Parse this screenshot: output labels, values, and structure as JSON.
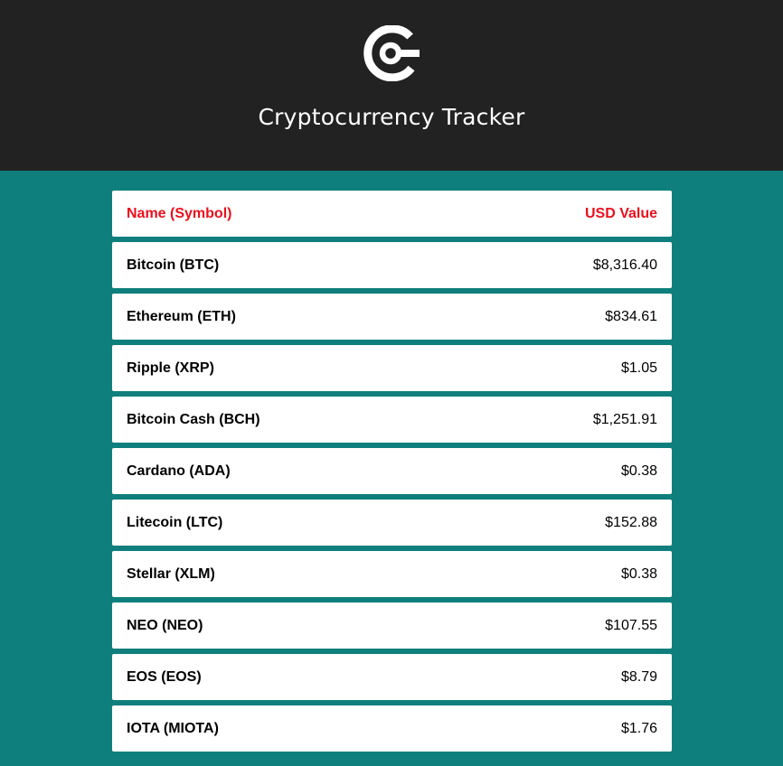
{
  "header": {
    "title": "Cryptocurrency Tracker",
    "logo_icon": "crypto-c-logo-icon"
  },
  "colors": {
    "header_bg": "#222222",
    "page_bg": "#0f7f7d",
    "header_text": "#e8101c"
  },
  "table": {
    "columns": [
      "Name (Symbol)",
      "USD Value"
    ],
    "rows": [
      {
        "name": "Bitcoin (BTC)",
        "value": "$8,316.40"
      },
      {
        "name": "Ethereum (ETH)",
        "value": "$834.61"
      },
      {
        "name": "Ripple (XRP)",
        "value": "$1.05"
      },
      {
        "name": "Bitcoin Cash (BCH)",
        "value": "$1,251.91"
      },
      {
        "name": "Cardano (ADA)",
        "value": "$0.38"
      },
      {
        "name": "Litecoin (LTC)",
        "value": "$152.88"
      },
      {
        "name": "Stellar (XLM)",
        "value": "$0.38"
      },
      {
        "name": "NEO (NEO)",
        "value": "$107.55"
      },
      {
        "name": "EOS (EOS)",
        "value": "$8.79"
      },
      {
        "name": "IOTA (MIOTA)",
        "value": "$1.76"
      }
    ]
  }
}
